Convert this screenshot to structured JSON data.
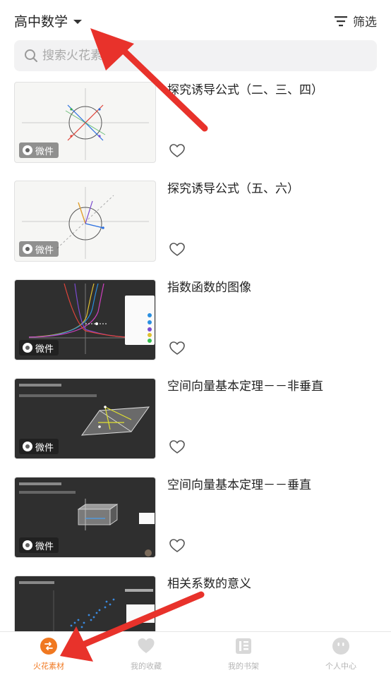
{
  "header": {
    "subject": "高中数学",
    "filter_label": "筛选"
  },
  "search": {
    "placeholder": "搜索火花素材"
  },
  "items": [
    {
      "title": "探究诱导公式（二、三、四）",
      "badge": "微件"
    },
    {
      "title": "探究诱导公式（五、六）",
      "badge": "微件"
    },
    {
      "title": "指数函数的图像",
      "badge": "微件"
    },
    {
      "title": "空间向量基本定理－－非垂直",
      "badge": "微件"
    },
    {
      "title": "空间向量基本定理－－垂直",
      "badge": "微件"
    },
    {
      "title": "相关系数的意义",
      "badge": ""
    }
  ],
  "tabbar": {
    "tabs": [
      {
        "label": "火花素材",
        "icon": "spark-icon",
        "active": true
      },
      {
        "label": "我的收藏",
        "icon": "heart-icon",
        "active": false
      },
      {
        "label": "我的书架",
        "icon": "bookshelf-icon",
        "active": false
      },
      {
        "label": "个人中心",
        "icon": "face-icon",
        "active": false
      }
    ]
  },
  "colors": {
    "accent": "#f07820",
    "annotation_arrow": "#e8322b",
    "search_bg": "#f2f2f3",
    "dark_thumb": "#2f2f2f"
  }
}
